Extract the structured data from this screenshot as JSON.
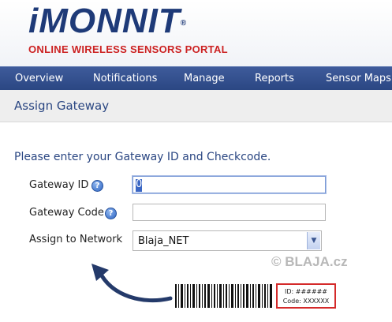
{
  "header": {
    "logo_i": "i",
    "logo_rest": "MONNIT",
    "logo_reg": "®",
    "tagline": "ONLINE WIRELESS SENSORS PORTAL",
    "brand_blue": "#1e3a78",
    "brand_red": "#cc2222"
  },
  "nav": {
    "items": [
      "Overview",
      "Notifications",
      "Manage",
      "Reports",
      "Sensor Maps"
    ],
    "color": "#2a4682"
  },
  "page": {
    "title": "Assign Gateway",
    "prompt": "Please enter your Gateway ID and Checkcode."
  },
  "form": {
    "gateway_id_label": "Gateway ID",
    "gateway_id_value": "0",
    "gateway_code_label": "Gateway Code",
    "gateway_code_value": "",
    "network_label": "Assign to Network",
    "network_value": "Blaja_NET",
    "help_glyph": "?",
    "dropdown_glyph": "▼"
  },
  "annotation": {
    "watermark": "© BLAJA.cz",
    "id_line": "ID: ######",
    "code_line": "Code: XXXXXX",
    "box_color": "#d42a2a"
  }
}
